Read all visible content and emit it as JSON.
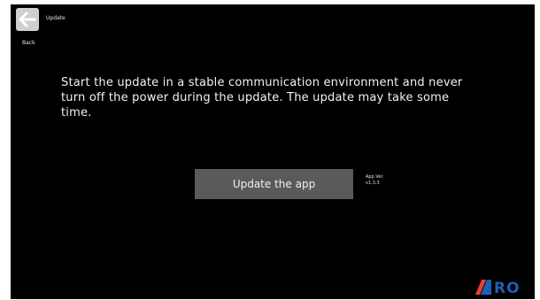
{
  "header": {
    "back_label": "Back",
    "title": "Update",
    "back_icon": "arrow-left-icon"
  },
  "main": {
    "message": "Start the update in a stable communication environment and never turn off the power during the update. The update may take some time.",
    "update_button_label": "Update the app",
    "app_version_label": "App Ver.",
    "app_version_value": "v1.3.3"
  },
  "footer": {
    "brand_logo": "RO",
    "logo_icon": "brand-logo-icon"
  },
  "colors": {
    "background": "#000000",
    "button": "#5a5a5a",
    "back_button": "#cfcfcf",
    "logo_red": "#e8412c",
    "logo_blue": "#1f5fb8"
  }
}
